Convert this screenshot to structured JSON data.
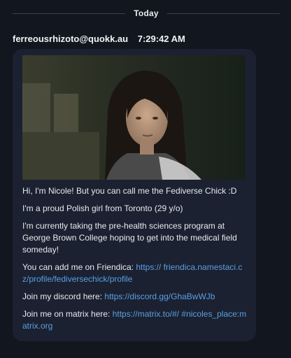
{
  "divider": {
    "label": "Today"
  },
  "message": {
    "author": "ferreousrhizoto@quokk.au",
    "time": "7:29:42 AM",
    "lines": {
      "intro": "Hi, I'm Nicole! But you can call me the Fediverse Chick :D",
      "origin": "I'm a proud Polish girl from Toronto (29 y/o)",
      "study": "I'm currently taking the pre-health sciences program at George Brown College hoping to get into the medical field someday!",
      "friendica_label": "You can add me on Friendica: ",
      "friendica_link": "https:// friendica.namestaci.cz/profile/fediversechick/profile",
      "discord_label": "Join my discord here: ",
      "discord_link": "https://discord.gg/GhaBwWJb",
      "matrix_label": "Join me on matrix here: ",
      "matrix_link": "https://matrix.to/#/ #nicoles_place:matrix.org"
    }
  },
  "colors": {
    "background": "#12161f",
    "bubble": "#1b2130",
    "link": "#5b9fe3",
    "text": "#e7e9ee"
  }
}
